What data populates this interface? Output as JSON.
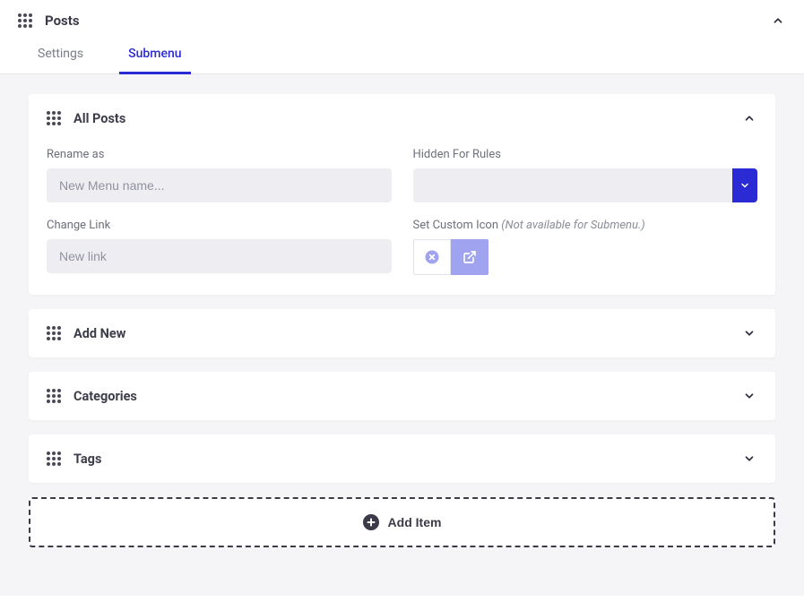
{
  "header": {
    "title": "Posts"
  },
  "tabs": {
    "settings": "Settings",
    "submenu": "Submenu"
  },
  "cards": {
    "allPosts": {
      "title": "All Posts",
      "renameLabel": "Rename as",
      "renamePlaceholder": "New Menu name...",
      "hiddenLabel": "Hidden For Rules",
      "changeLinkLabel": "Change Link",
      "changeLinkPlaceholder": "New link",
      "customIconLabel": "Set Custom Icon",
      "customIconNote": "(Not available for Submenu.)"
    },
    "addNew": {
      "title": "Add New"
    },
    "categories": {
      "title": "Categories"
    },
    "tags": {
      "title": "Tags"
    }
  },
  "addItem": {
    "label": "Add Item"
  }
}
